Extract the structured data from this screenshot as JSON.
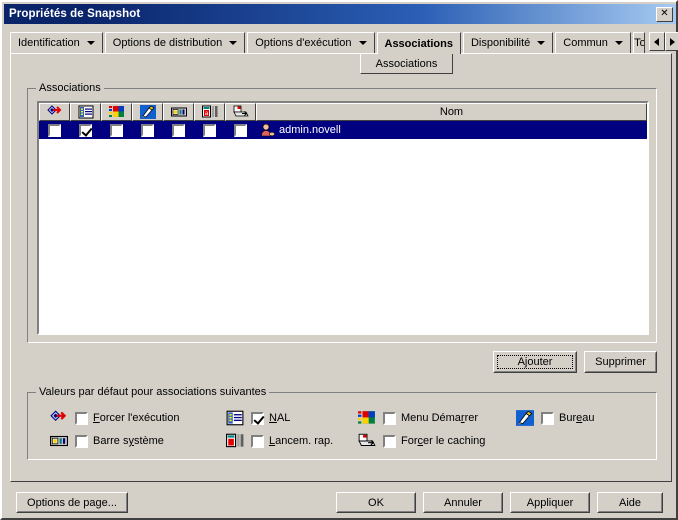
{
  "window": {
    "title": "Propriétés de Snapshot",
    "close_label": "✕"
  },
  "tabs": [
    {
      "label": "Identification",
      "has_dropdown": true,
      "active": false
    },
    {
      "label": "Options de distribution",
      "has_dropdown": true,
      "active": false
    },
    {
      "label": "Options d'exécution",
      "has_dropdown": true,
      "active": false
    },
    {
      "label": "Associations",
      "has_dropdown": false,
      "active": true
    },
    {
      "label": "Disponibilité",
      "has_dropdown": true,
      "active": false
    },
    {
      "label": "Commun",
      "has_dropdown": true,
      "active": false
    },
    {
      "label": "To",
      "has_dropdown": false,
      "active": false
    }
  ],
  "tab_sublabel": "Associations",
  "scroll": {
    "left": "◄",
    "right": "►"
  },
  "groupbox_associations": {
    "label": "Associations",
    "columns": [
      {
        "icon": "force-run-icon",
        "title": "Forcer l'exécution"
      },
      {
        "icon": "nal-window-icon",
        "title": "NAL"
      },
      {
        "icon": "start-menu-icon",
        "title": "Menu Démarrer"
      },
      {
        "icon": "desktop-icon",
        "title": "Bureau"
      },
      {
        "icon": "system-tray-icon",
        "title": "Barre système"
      },
      {
        "icon": "quick-launch-icon",
        "title": "Lancem. rap."
      },
      {
        "icon": "force-cache-icon",
        "title": "Forcer le caching"
      }
    ],
    "name_column_header": "Nom",
    "rows": [
      {
        "name": "admin.novell",
        "icon": "user-object-icon",
        "selected": true,
        "checks": [
          false,
          true,
          false,
          false,
          false,
          false,
          false
        ]
      }
    ]
  },
  "buttons": {
    "ajouter": "Ajouter",
    "supprimer": "Supprimer",
    "options_de_page": "Options de page...",
    "ok": "OK",
    "annuler": "Annuler",
    "appliquer": "Appliquer",
    "aide": "Aide"
  },
  "groupbox_defaults": {
    "label": "Valeurs par défaut pour associations suivantes",
    "options": [
      {
        "label": "Forcer l'exécution",
        "accel": "F",
        "checked": false,
        "icon": "force-run-icon"
      },
      {
        "label": "NAL",
        "accel": "N",
        "checked": true,
        "icon": "nal-window-icon"
      },
      {
        "label": "Menu Démarrer",
        "accel": "r",
        "checked": false,
        "icon": "start-menu-icon"
      },
      {
        "label": "Bureau",
        "accel": "e",
        "checked": false,
        "icon": "desktop-icon"
      },
      {
        "label": "Barre système",
        "accel": "y",
        "checked": false,
        "icon": "system-tray-icon"
      },
      {
        "label": "Lancem. rap.",
        "accel": "L",
        "checked": false,
        "icon": "quick-launch-icon"
      },
      {
        "label": "Forcer le caching",
        "accel": "c",
        "checked": false,
        "icon": "force-cache-icon"
      }
    ]
  },
  "colors": {
    "face": "#d4d0c8",
    "title_start": "#0a246a",
    "title_end": "#a6caf0",
    "selection": "#000080",
    "list_bg": "#ffffff"
  }
}
